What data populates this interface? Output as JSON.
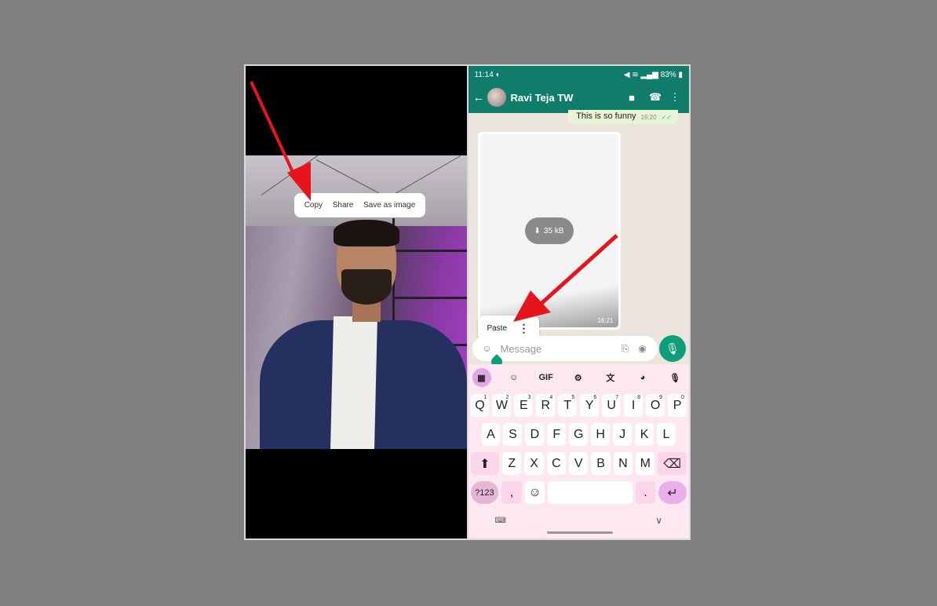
{
  "left_panel": {
    "context_menu": {
      "items": [
        "Copy",
        "Share",
        "Save as image"
      ]
    }
  },
  "right_panel": {
    "status_bar": {
      "time": "11:14",
      "icons": "◐",
      "right": "♪⚡ 83%",
      "battery": "83%"
    },
    "header": {
      "contact_name": "Ravi Teja TW",
      "back_icon": "←",
      "video_icon": "■",
      "call_icon": "☎",
      "more_icon": "⋮"
    },
    "messages": [
      {
        "direction": "outgoing",
        "text": "This is so funny",
        "time": "16:20",
        "ticks": "✓✓"
      },
      {
        "direction": "incoming",
        "type": "image",
        "size": "35 kB",
        "time": "16:21"
      }
    ],
    "paste_popup": {
      "label": "Paste",
      "more_icon": "⋮"
    },
    "composer": {
      "placeholder": "Message",
      "emoji_icon": "☺",
      "attach_icon": "⎘",
      "camera_icon": "◉",
      "mic_icon": "●"
    },
    "keyboard": {
      "toolbar": [
        "▦",
        "☺",
        "GIF",
        "⚙",
        "文",
        "◕",
        "●"
      ],
      "row1": [
        {
          "k": "Q",
          "n": "1"
        },
        {
          "k": "W",
          "n": "2"
        },
        {
          "k": "E",
          "n": "3"
        },
        {
          "k": "R",
          "n": "4"
        },
        {
          "k": "T",
          "n": "5"
        },
        {
          "k": "Y",
          "n": "6"
        },
        {
          "k": "U",
          "n": "7"
        },
        {
          "k": "I",
          "n": "8"
        },
        {
          "k": "O",
          "n": "9"
        },
        {
          "k": "P",
          "n": "0"
        }
      ],
      "row2": [
        "A",
        "S",
        "D",
        "F",
        "G",
        "H",
        "J",
        "K",
        "L"
      ],
      "row3": [
        "Z",
        "X",
        "C",
        "V",
        "B",
        "N",
        "M"
      ],
      "shift": "⬆",
      "backspace": "⌫",
      "symbols": "?123",
      "comma": ",",
      "emoji": "☺",
      "period": ".",
      "enter": "↵",
      "kb_switch": "⌨",
      "hide": "∨"
    }
  }
}
